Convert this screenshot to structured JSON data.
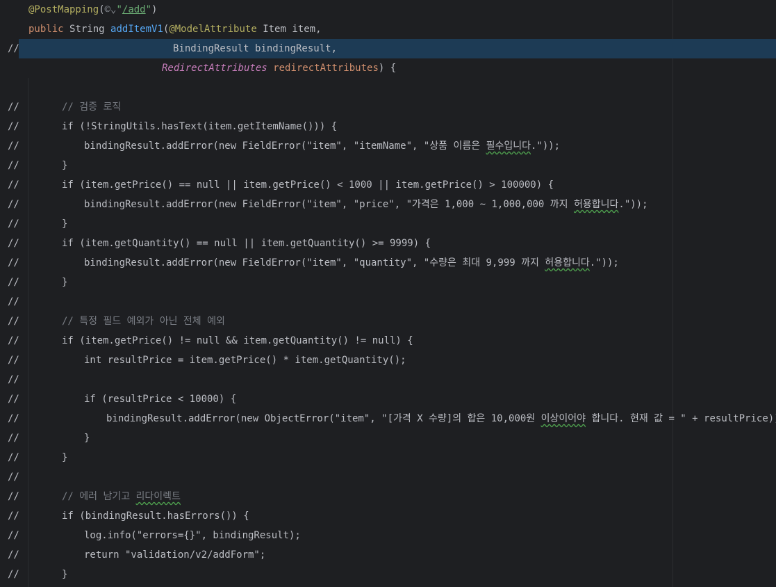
{
  "editor": {
    "language": "java",
    "comment_prefix": "//",
    "lines": [
      {
        "indent": 41,
        "commented": false,
        "tokens": [
          {
            "t": "@PostMapping",
            "c": "ann"
          },
          {
            "t": "(",
            "c": "cls"
          },
          {
            "t": "©⌄",
            "c": "url-icon"
          },
          {
            "t": "\"",
            "c": "str"
          },
          {
            "t": "/add",
            "c": "link"
          },
          {
            "t": "\"",
            "c": "str"
          },
          {
            "t": ")",
            "c": "cls"
          }
        ]
      },
      {
        "indent": 41,
        "commented": false,
        "tokens": [
          {
            "t": "public ",
            "c": "kw"
          },
          {
            "t": "String ",
            "c": "cls"
          },
          {
            "t": "addItemV1",
            "c": "fn"
          },
          {
            "t": "(",
            "c": "cls"
          },
          {
            "t": "@ModelAttribute ",
            "c": "ann"
          },
          {
            "t": "Item ",
            "c": "cls"
          },
          {
            "t": "item",
            "c": "param"
          },
          {
            "t": ",",
            "c": "cls"
          }
        ]
      },
      {
        "indent": 249,
        "commented": true,
        "selected": true,
        "tokens": [
          {
            "t": "BindingResult bindingResult,",
            "c": "cls"
          }
        ]
      },
      {
        "indent": 233,
        "commented": false,
        "tokens": [
          {
            "t": "RedirectAttributes ",
            "c": "ital"
          },
          {
            "t": "redirectAttributes",
            "c": "kw"
          },
          {
            "t": ") {",
            "c": "cls"
          }
        ]
      },
      {
        "indent": 0,
        "commented": false,
        "tokens": []
      },
      {
        "indent": 89,
        "commented": true,
        "tokens": [
          {
            "t": "// 검증 로직",
            "c": "comment"
          }
        ]
      },
      {
        "indent": 89,
        "commented": true,
        "tokens": [
          {
            "t": "if (!StringUtils.hasText(item.getItemName())) {",
            "c": "cls"
          }
        ]
      },
      {
        "indent": 121,
        "commented": true,
        "tokens": [
          {
            "t": "bindingResult.addError(new FieldError(\"item\", \"itemName\", \"상품 이름은 ",
            "c": "cls"
          },
          {
            "t": "필수입니다",
            "c": "cls warn"
          },
          {
            "t": ".\"));",
            "c": "cls"
          }
        ]
      },
      {
        "indent": 89,
        "commented": true,
        "tokens": [
          {
            "t": "}",
            "c": "cls"
          }
        ]
      },
      {
        "indent": 89,
        "commented": true,
        "tokens": [
          {
            "t": "if (item.getPrice() == null || item.getPrice() < 1000 || item.getPrice() > 100000) {",
            "c": "cls"
          }
        ]
      },
      {
        "indent": 121,
        "commented": true,
        "tokens": [
          {
            "t": "bindingResult.addError(new FieldError(\"item\", \"price\", \"가격은 1,000 ~ 1,000,000 까지 ",
            "c": "cls"
          },
          {
            "t": "허용합니다",
            "c": "cls warn"
          },
          {
            "t": ".\"));",
            "c": "cls"
          }
        ]
      },
      {
        "indent": 89,
        "commented": true,
        "tokens": [
          {
            "t": "}",
            "c": "cls"
          }
        ]
      },
      {
        "indent": 89,
        "commented": true,
        "tokens": [
          {
            "t": "if (item.getQuantity() == null || item.getQuantity() >= 9999) {",
            "c": "cls"
          }
        ]
      },
      {
        "indent": 121,
        "commented": true,
        "tokens": [
          {
            "t": "bindingResult.addError(new FieldError(\"item\", \"quantity\", \"수량은 최대 9,999 까지 ",
            "c": "cls"
          },
          {
            "t": "허용합니다",
            "c": "cls warn"
          },
          {
            "t": ".\"));",
            "c": "cls"
          }
        ]
      },
      {
        "indent": 89,
        "commented": true,
        "tokens": [
          {
            "t": "}",
            "c": "cls"
          }
        ]
      },
      {
        "indent": 0,
        "commented": true,
        "tokens": []
      },
      {
        "indent": 89,
        "commented": true,
        "tokens": [
          {
            "t": "// 특정 필드 예외가 아닌 전체 예외",
            "c": "comment"
          }
        ]
      },
      {
        "indent": 89,
        "commented": true,
        "tokens": [
          {
            "t": "if (item.getPrice() != null && item.getQuantity() != null) {",
            "c": "cls"
          }
        ]
      },
      {
        "indent": 121,
        "commented": true,
        "tokens": [
          {
            "t": "int resultPrice = item.getPrice() * item.getQuantity();",
            "c": "cls"
          }
        ]
      },
      {
        "indent": 0,
        "commented": true,
        "tokens": []
      },
      {
        "indent": 121,
        "commented": true,
        "tokens": [
          {
            "t": "if (resultPrice < 10000) {",
            "c": "cls"
          }
        ]
      },
      {
        "indent": 153,
        "commented": true,
        "tokens": [
          {
            "t": "bindingResult.addError(new ObjectError(\"item\", \"[가격 X 수량]의 합은 10,000원 ",
            "c": "cls"
          },
          {
            "t": "이상이어야",
            "c": "cls warn"
          },
          {
            "t": " 합니다. 현재 값 = \" + resultPrice));",
            "c": "cls"
          }
        ]
      },
      {
        "indent": 121,
        "commented": true,
        "tokens": [
          {
            "t": "}",
            "c": "cls"
          }
        ]
      },
      {
        "indent": 89,
        "commented": true,
        "tokens": [
          {
            "t": "}",
            "c": "cls"
          }
        ]
      },
      {
        "indent": 0,
        "commented": true,
        "tokens": []
      },
      {
        "indent": 89,
        "commented": true,
        "tokens": [
          {
            "t": "// 에러 남기고 ",
            "c": "comment"
          },
          {
            "t": "리다이렉트",
            "c": "comment warn"
          }
        ]
      },
      {
        "indent": 89,
        "commented": true,
        "tokens": [
          {
            "t": "if (bindingResult.hasErrors()) {",
            "c": "cls"
          }
        ]
      },
      {
        "indent": 121,
        "commented": true,
        "tokens": [
          {
            "t": "log.info(\"errors={}\", bindingResult);",
            "c": "cls"
          }
        ]
      },
      {
        "indent": 121,
        "commented": true,
        "tokens": [
          {
            "t": "return \"validation/v2/addForm\";",
            "c": "cls"
          }
        ]
      },
      {
        "indent": 89,
        "commented": true,
        "tokens": [
          {
            "t": "}",
            "c": "cls"
          }
        ]
      }
    ]
  }
}
